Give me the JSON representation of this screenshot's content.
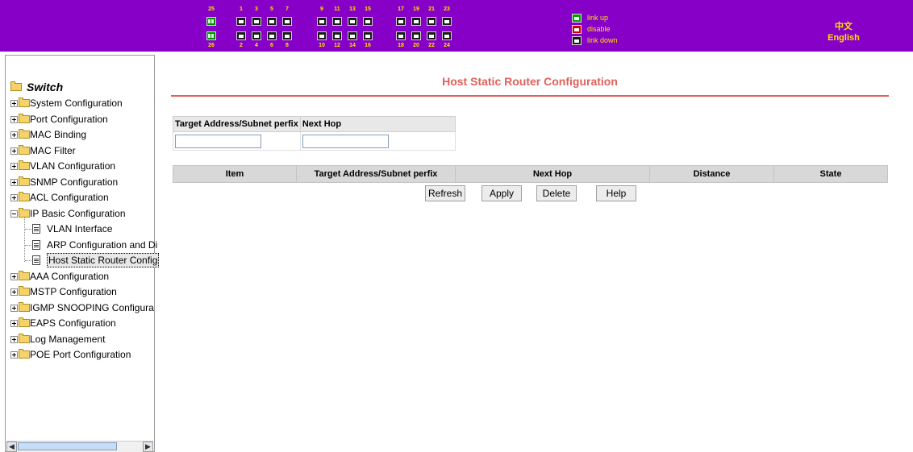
{
  "header": {
    "ports_top_numbers": [
      "25",
      "1",
      "3",
      "5",
      "7",
      "9",
      "11",
      "13",
      "15",
      "17",
      "19",
      "21",
      "23"
    ],
    "ports_bottom_numbers": [
      "26",
      "2",
      "4",
      "6",
      "8",
      "10",
      "12",
      "14",
      "16",
      "18",
      "20",
      "22",
      "24"
    ],
    "legend": [
      {
        "label": "link up",
        "icon": "port-link-up-icon",
        "color": "#00a000"
      },
      {
        "label": "disable",
        "icon": "port-disable-icon",
        "color": "#d00000"
      },
      {
        "label": "link down",
        "icon": "port-link-down-icon",
        "color": "#1a1a1a"
      }
    ],
    "lang_chinese": "中文",
    "lang_english": "English",
    "background_color": "#8600c8",
    "text_color": "#ffe000"
  },
  "sidebar": {
    "root_label": "Switch",
    "items": [
      {
        "label": "System Configuration",
        "type": "folder",
        "expanded": false
      },
      {
        "label": "Port Configuration",
        "type": "folder",
        "expanded": false
      },
      {
        "label": "MAC Binding",
        "type": "folder",
        "expanded": false
      },
      {
        "label": "MAC Filter",
        "type": "folder",
        "expanded": false
      },
      {
        "label": "VLAN Configuration",
        "type": "folder",
        "expanded": false
      },
      {
        "label": "SNMP Configuration",
        "type": "folder",
        "expanded": false
      },
      {
        "label": "ACL Configuration",
        "type": "folder",
        "expanded": false
      },
      {
        "label": "IP Basic Configuration",
        "type": "folder",
        "expanded": true
      },
      {
        "label": "VLAN Interface",
        "type": "page"
      },
      {
        "label": "ARP Configuration and Di",
        "type": "page"
      },
      {
        "label": "Host Static Router Config",
        "type": "page",
        "selected": true
      },
      {
        "label": "AAA Configuration",
        "type": "folder",
        "expanded": false
      },
      {
        "label": "MSTP Configuration",
        "type": "folder",
        "expanded": false
      },
      {
        "label": "IGMP SNOOPING Configura",
        "type": "folder",
        "expanded": false
      },
      {
        "label": "EAPS Configuration",
        "type": "folder",
        "expanded": false
      },
      {
        "label": "Log Management",
        "type": "folder",
        "expanded": false
      },
      {
        "label": "POE Port Configuration",
        "type": "folder",
        "expanded": false
      }
    ]
  },
  "main": {
    "title": "Host Static Router Configuration",
    "title_color": "#e0605a",
    "form": {
      "col_target": "Target Address/Subnet perfix",
      "col_nexthop": "Next Hop",
      "target_value": "",
      "nexthop_value": ""
    },
    "table": {
      "headers": [
        "Item",
        "Target Address/Subnet perfix",
        "Next Hop",
        "Distance",
        "State"
      ]
    },
    "buttons": {
      "refresh": "Refresh",
      "apply": "Apply",
      "delete": "Delete",
      "help": "Help"
    }
  }
}
